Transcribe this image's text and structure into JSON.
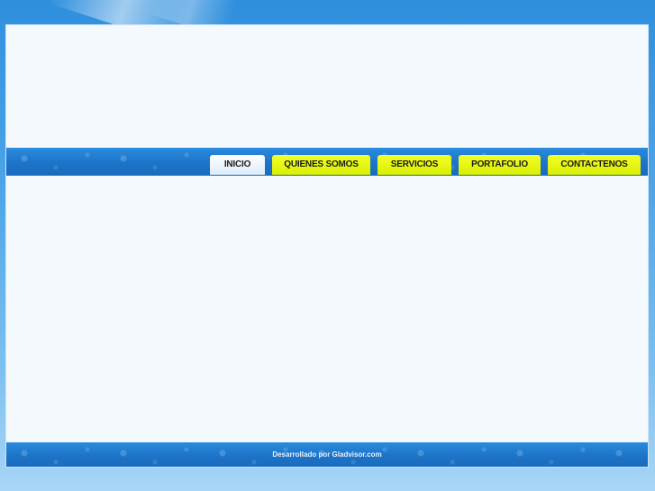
{
  "nav": {
    "items": [
      {
        "label": "INICIO",
        "active": true
      },
      {
        "label": "QUIENES SOMOS",
        "active": false
      },
      {
        "label": "SERVICIOS",
        "active": false
      },
      {
        "label": "PORTAFOLIO",
        "active": false
      },
      {
        "label": "CONTACTENOS",
        "active": false
      }
    ]
  },
  "footer": {
    "credit": "Desarrollado por Gladvisor.com"
  },
  "colors": {
    "background": "#4fa6e8",
    "nav_bar": "#1d74c8",
    "tab_active": "#e8f2fb",
    "tab_normal": "#e8f700",
    "content": "#f4f9fd"
  }
}
